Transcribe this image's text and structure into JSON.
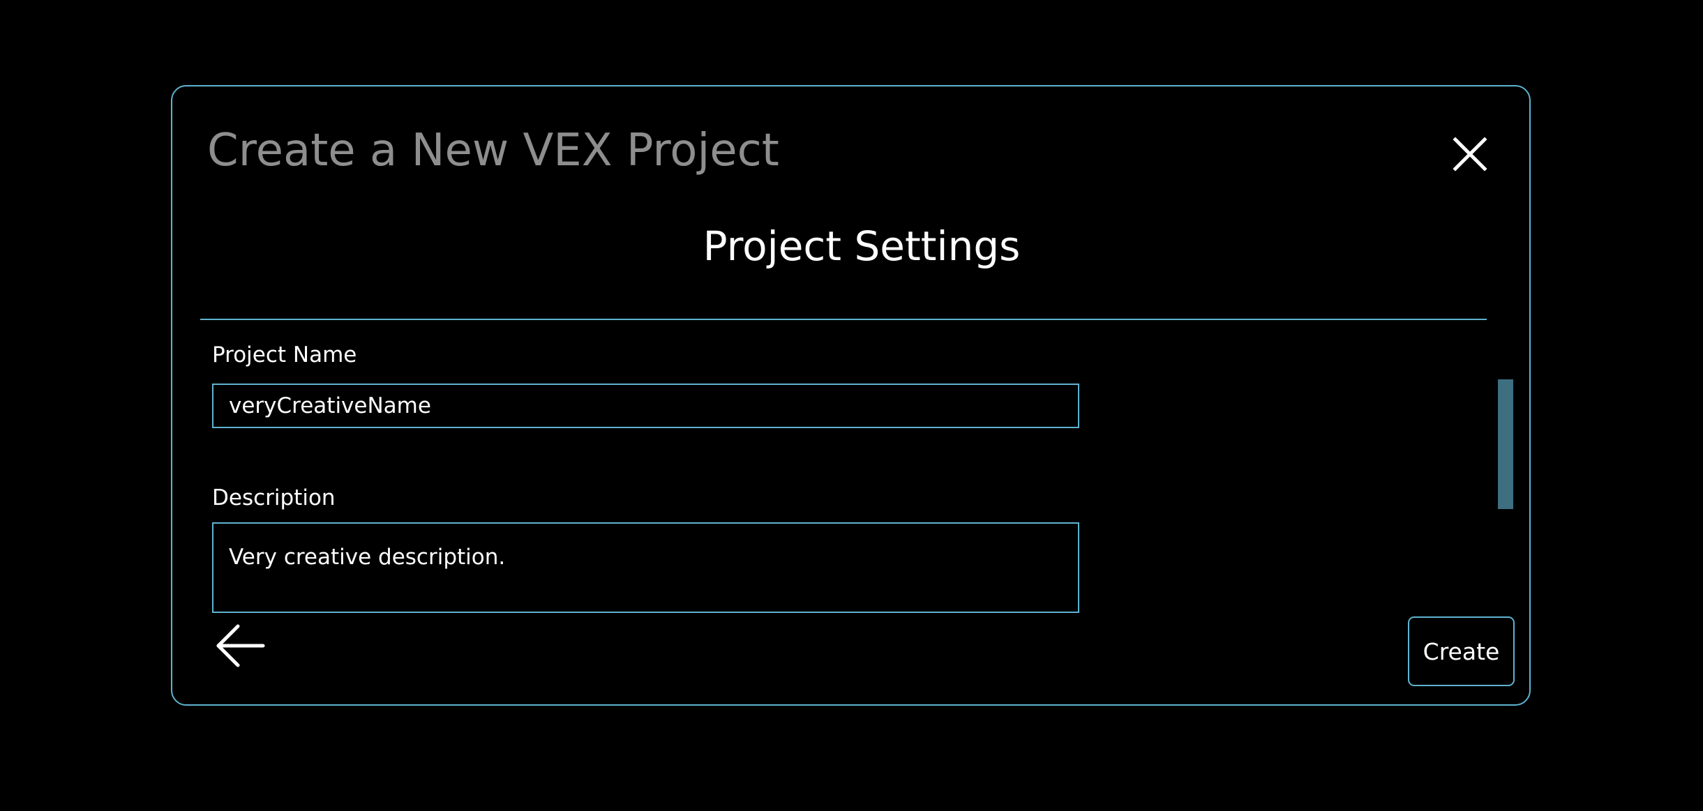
{
  "dialog": {
    "title": "Create a New VEX Project",
    "close_icon": "close-icon"
  },
  "settings": {
    "section_title": "Project Settings",
    "project_name": {
      "label": "Project Name",
      "value": "veryCreativeName"
    },
    "description": {
      "label": "Description",
      "value": "Very creative description."
    }
  },
  "footer": {
    "back_icon": "arrow-left-icon",
    "create_label": "Create"
  },
  "colors": {
    "background": "#000000",
    "accent_border": "#5fb3d1",
    "title_gray": "#8e8e8e",
    "scrollbar": "#3d6f80",
    "text": "#ffffff"
  }
}
